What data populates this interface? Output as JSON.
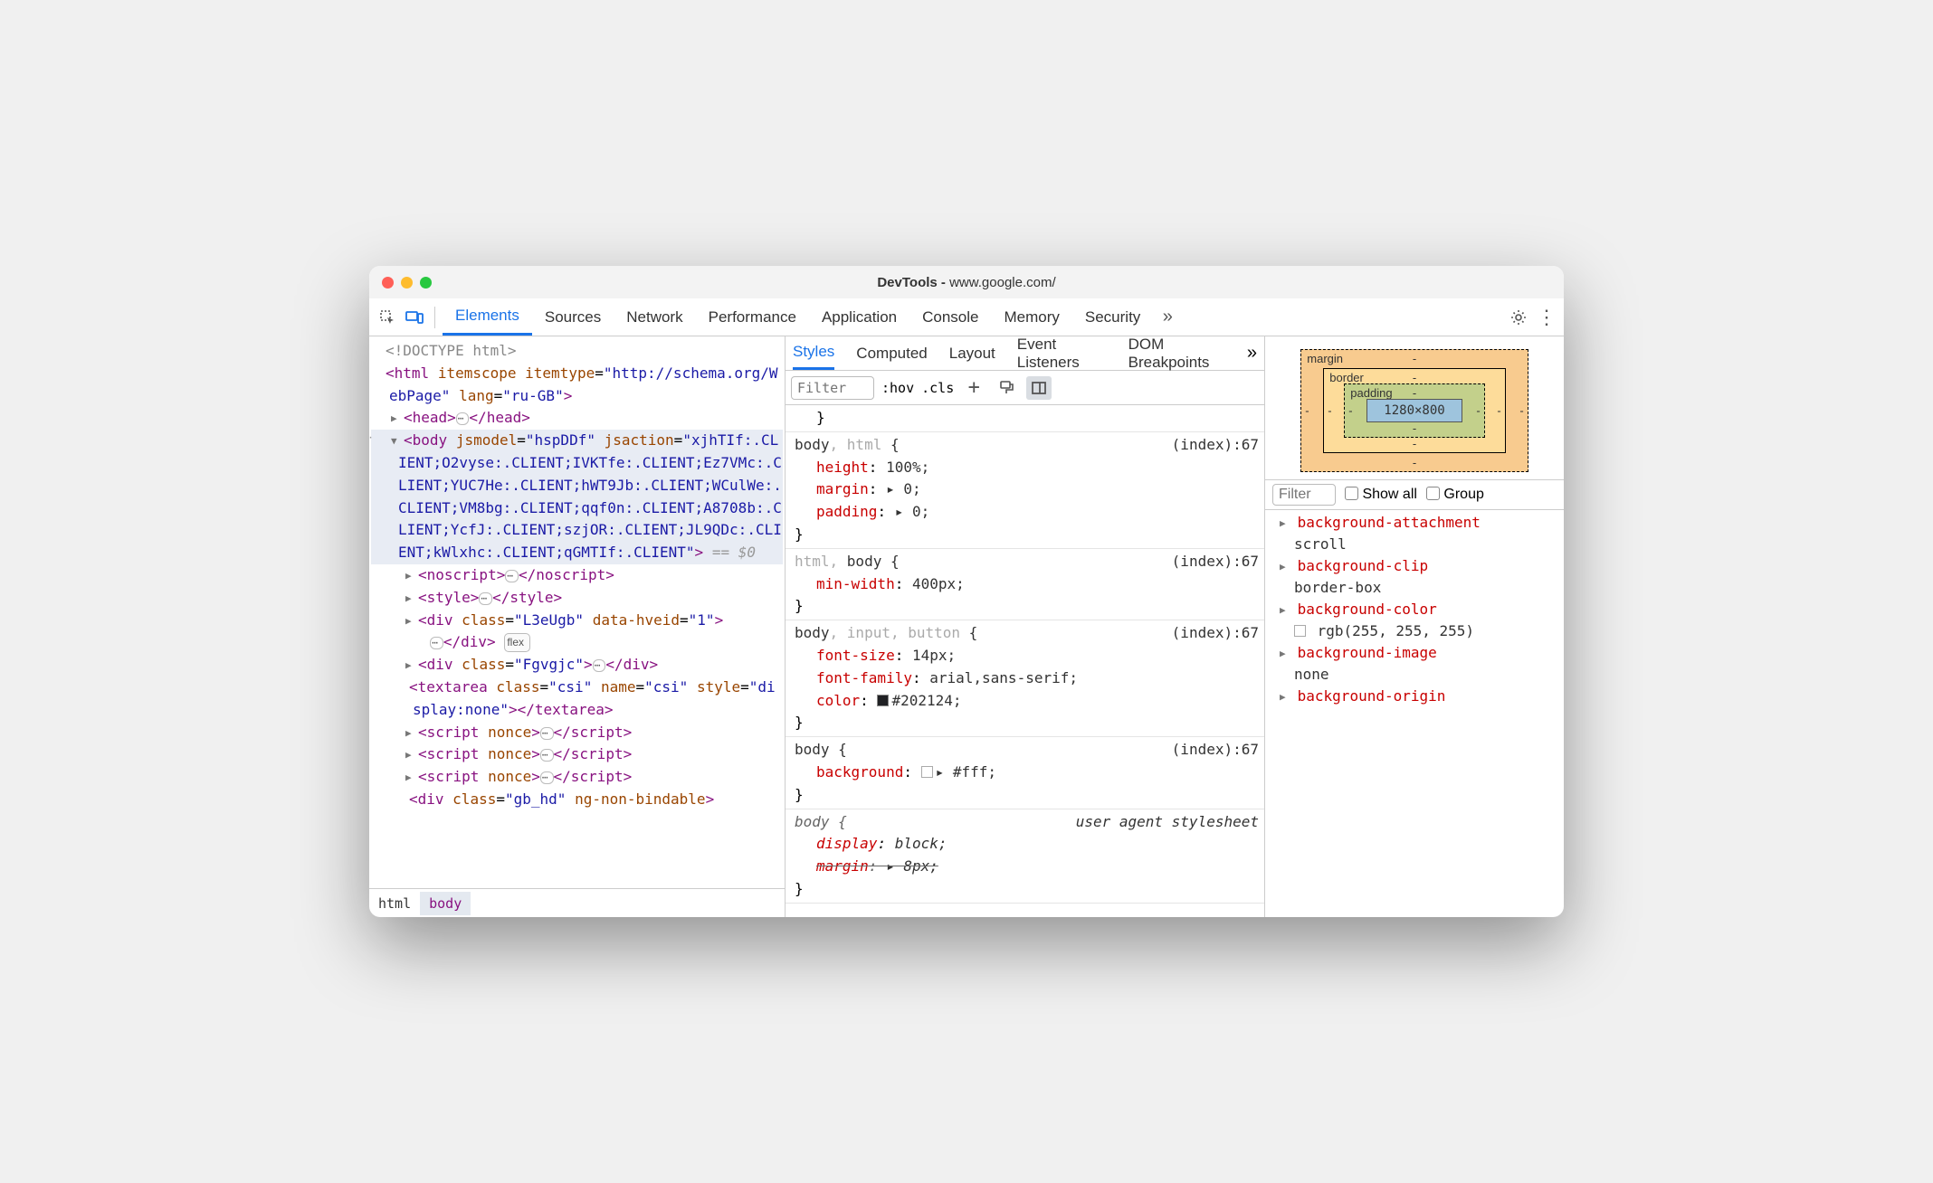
{
  "window": {
    "title_prefix": "DevTools - ",
    "title_url": "www.google.com/"
  },
  "tabs": {
    "items": [
      "Elements",
      "Sources",
      "Network",
      "Performance",
      "Application",
      "Console",
      "Memory",
      "Security"
    ],
    "active": "Elements"
  },
  "dom": {
    "doctype": "<!DOCTYPE html>",
    "html_attrs": {
      "itemscope": "itemscope",
      "itemtype": "http://schema.org/WebPage",
      "lang": "ru-GB"
    },
    "body_attrs_jsmodel": "hspDDf",
    "body_jsaction": "xjhTIf:.CLIENT;O2vyse:.CLIENT;IVKTfe:.CLIENT;Ez7VMc:.CLIENT;YUC7He:.CLIENT;hWT9Jb:.CLIENT;WCulWe:.CLIENT;VM8bg:.CLIENT;qqf0n:.CLIENT;A8708b:.CLIENT;YcfJ:.CLIENT;szjOR:.CLIENT;JL9QDc:.CLIENT;kWlxhc:.CLIENT;qGMTIf:.CLIENT",
    "children": [
      {
        "tag": "head",
        "collapsed": true
      },
      {
        "tag": "noscript",
        "collapsed": true
      },
      {
        "tag": "style",
        "collapsed": true
      },
      {
        "tag": "div",
        "attrs": "class=\"L3eUgb\" data-hveid=\"1\"",
        "collapsed": true,
        "badge": "flex"
      },
      {
        "tag": "div",
        "attrs": "class=\"Fgvgjc\"",
        "collapsed": true,
        "inline": true
      },
      {
        "tag": "textarea",
        "attrs": "class=\"csi\" name=\"csi\" style=\"display:none\"",
        "self": true
      },
      {
        "tag": "script",
        "attrs": "nonce",
        "collapsed": true
      },
      {
        "tag": "script",
        "attrs": "nonce",
        "collapsed": true
      },
      {
        "tag": "script",
        "attrs": "nonce",
        "collapsed": true
      },
      {
        "tag": "div",
        "attrs": "class=\"gb_hd\" ng-non-bindable",
        "open": true
      }
    ],
    "eq0": "== $0"
  },
  "crumbs": [
    "html",
    "body"
  ],
  "subtabs": {
    "items": [
      "Styles",
      "Computed",
      "Layout",
      "Event Listeners",
      "DOM Breakpoints"
    ],
    "active": "Styles"
  },
  "filterbar": {
    "filter_placeholder": "Filter",
    "hov": ":hov",
    "cls": ".cls"
  },
  "rules": [
    {
      "selector": "body, html",
      "selector_dim": ", html",
      "location": "(index):67",
      "decls": [
        {
          "p": "height",
          "v": "100%;"
        },
        {
          "p": "margin",
          "v": "▸ 0;"
        },
        {
          "p": "padding",
          "v": "▸ 0;"
        }
      ]
    },
    {
      "selector": "html, body",
      "selector_pre_dim": "html, ",
      "location": "(index):67",
      "decls": [
        {
          "p": "min-width",
          "v": "400px;"
        }
      ]
    },
    {
      "selector": "body, input, button",
      "selector_dim": ", input, button",
      "location": "(index):67",
      "decls": [
        {
          "p": "font-size",
          "v": "14px;"
        },
        {
          "p": "font-family",
          "v": "arial,sans-serif;"
        },
        {
          "p": "color",
          "v": "#202124;",
          "swatch": "#202124"
        }
      ]
    },
    {
      "selector": "body",
      "location": "(index):67",
      "decls": [
        {
          "p": "background",
          "v": "▸ #fff;",
          "swatch": "#ffffff",
          "swatch_border": true
        }
      ]
    },
    {
      "selector": "body",
      "location": "user agent stylesheet",
      "ua": true,
      "decls": [
        {
          "p": "display",
          "v": "block;",
          "italic": true
        },
        {
          "p": "margin",
          "v": "▸ 8px;",
          "strike": true
        }
      ]
    }
  ],
  "boxmodel": {
    "margin": {
      "t": "-",
      "r": "-",
      "b": "-",
      "l": "-"
    },
    "border": {
      "t": "-",
      "r": "-",
      "b": "-",
      "l": "-"
    },
    "padding": {
      "t": "-",
      "r": "-",
      "b": "-",
      "l": "-"
    },
    "content": "1280×800",
    "labels": {
      "margin": "margin",
      "border": "border",
      "padding": "padding"
    }
  },
  "computed_filter": {
    "placeholder": "Filter",
    "showall": "Show all",
    "group": "Group"
  },
  "computed": [
    {
      "k": "background-attachment",
      "v": "scroll"
    },
    {
      "k": "background-clip",
      "v": "border-box"
    },
    {
      "k": "background-color",
      "v": "rgb(255, 255, 255)",
      "swatch": "#ffffff"
    },
    {
      "k": "background-image",
      "v": "none"
    },
    {
      "k": "background-origin",
      "v": ""
    }
  ]
}
